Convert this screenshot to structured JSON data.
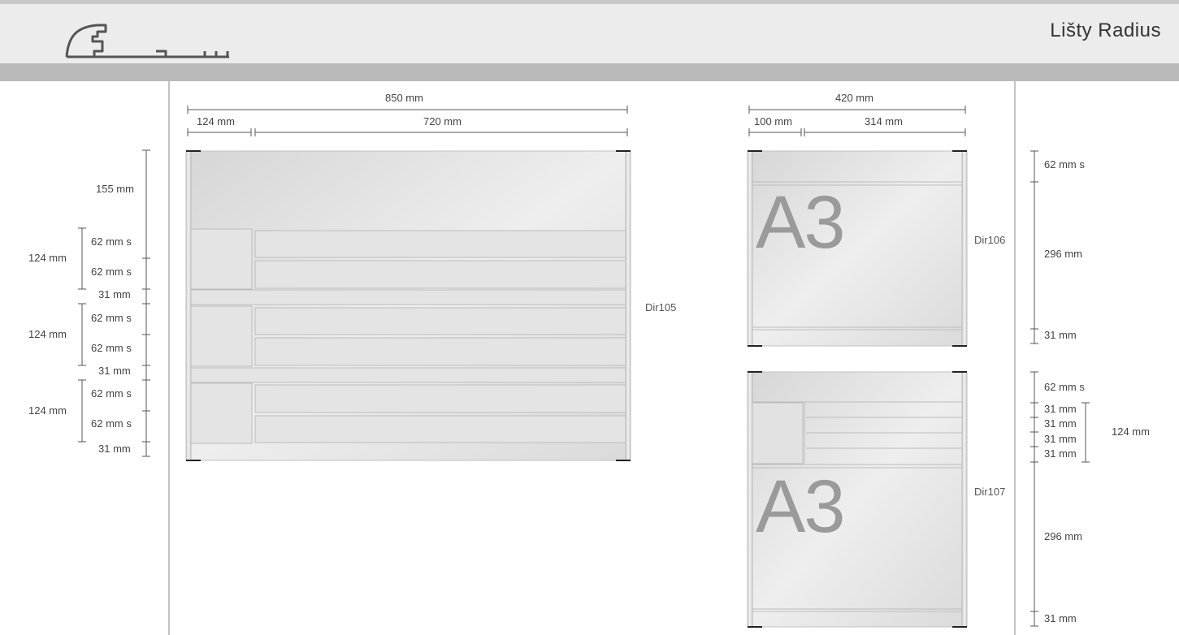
{
  "header": {
    "title": "Lišty Radius"
  },
  "dir105": {
    "code": "Dir105",
    "width_total": "850 mm",
    "width_left": "124 mm",
    "width_right": "720 mm",
    "h_top": "155 mm",
    "rows": [
      {
        "group": "124 mm",
        "a": "62 mm s",
        "b": "62 mm s",
        "gap": "31 mm"
      },
      {
        "group": "124 mm",
        "a": "62 mm s",
        "b": "62 mm s",
        "gap": "31 mm"
      },
      {
        "group": "124 mm",
        "a": "62 mm s",
        "b": "62 mm s",
        "gap": "31 mm"
      }
    ]
  },
  "dir106": {
    "code": "Dir106",
    "width_total": "420 mm",
    "width_left": "100 mm",
    "width_right": "314 mm",
    "h_top": "62 mm s",
    "h_mid": "296 mm",
    "h_bottom": "31 mm",
    "format": "A3"
  },
  "dir107": {
    "code": "Dir107",
    "h_top": "62 mm s",
    "h_rows": [
      "31 mm",
      "31 mm",
      "31 mm",
      "31 mm"
    ],
    "h_group": "124 mm",
    "h_mid": "296 mm",
    "h_bottom": "31 mm",
    "format": "A3"
  }
}
